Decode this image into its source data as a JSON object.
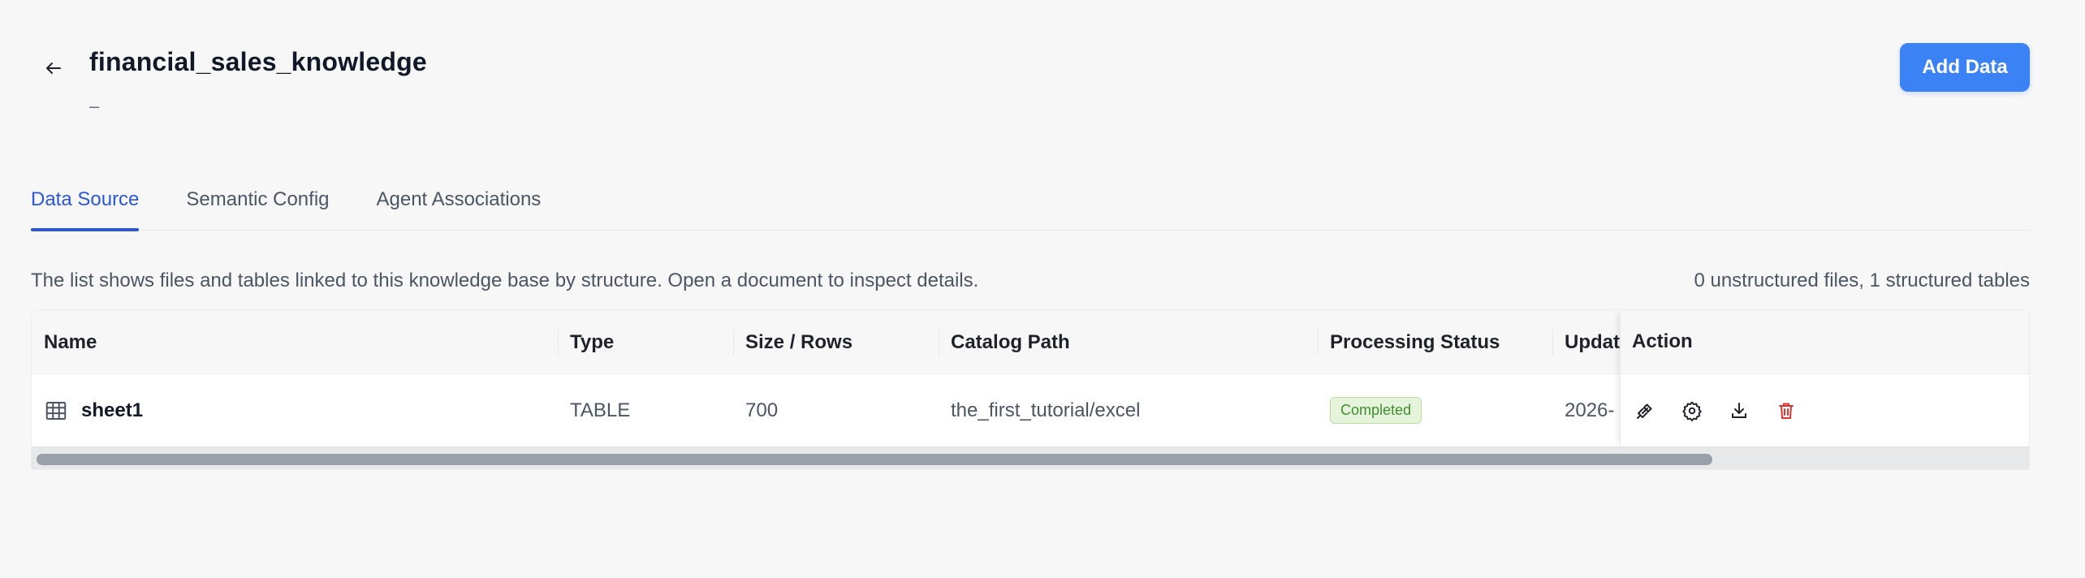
{
  "header": {
    "title": "financial_sales_knowledge",
    "subtitle": "–",
    "add_button_label": "Add Data"
  },
  "tabs": [
    {
      "label": "Data Source",
      "active": true
    },
    {
      "label": "Semantic Config",
      "active": false
    },
    {
      "label": "Agent Associations",
      "active": false
    }
  ],
  "info": {
    "description": "The list shows files and tables linked to this knowledge base by structure. Open a document to inspect details.",
    "counts": "0 unstructured files, 1 structured tables"
  },
  "table": {
    "columns": [
      "Name",
      "Type",
      "Size / Rows",
      "Catalog Path",
      "Processing Status",
      "Update",
      "Action"
    ],
    "rows": [
      {
        "name": "sheet1",
        "type": "TABLE",
        "size": "700",
        "catalog_path": "the_first_tutorial/excel",
        "status": "Completed",
        "updated": "2026-"
      }
    ]
  },
  "icons": {
    "back": "arrow-left-icon",
    "table": "table-grid-icon",
    "actions": [
      "link-icon",
      "gear-icon",
      "download-icon",
      "trash-icon"
    ]
  },
  "colors": {
    "accent": "#3b82f6",
    "active_tab": "#2b56d6",
    "status_completed_bg": "#e6f4dc",
    "status_completed_text": "#3f8f2f",
    "delete": "#e03131"
  }
}
